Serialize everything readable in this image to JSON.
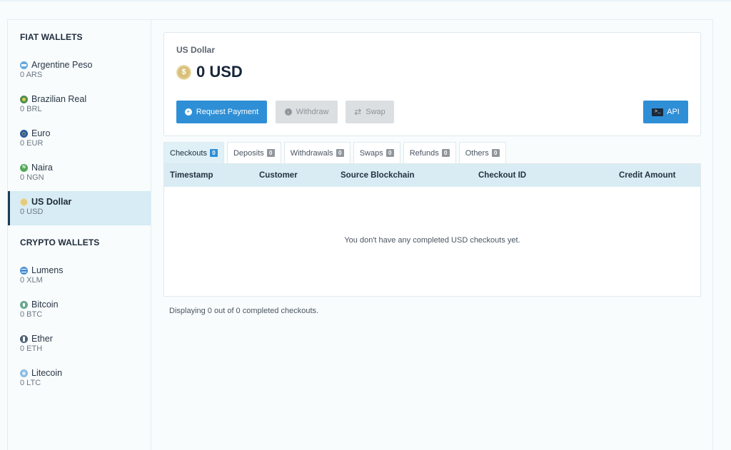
{
  "sidebar": {
    "fiat_title": "FIAT WALLETS",
    "crypto_title": "CRYPTO WALLETS",
    "fiat": [
      {
        "name": "Argentine Peso",
        "amount": "0 ARS",
        "icon": "ars-flag-icon",
        "color": "#6aa9e0",
        "glyph": ""
      },
      {
        "name": "Brazilian Real",
        "amount": "0 BRL",
        "icon": "brl-flag-icon",
        "color": "#4d8f4f",
        "glyph": ""
      },
      {
        "name": "Euro",
        "amount": "0 EUR",
        "icon": "eur-flag-icon",
        "color": "#2c5c9e",
        "glyph": ""
      },
      {
        "name": "Naira",
        "amount": "0 NGN",
        "icon": "ngn-flag-icon",
        "color": "#54a957",
        "glyph": "N"
      },
      {
        "name": "US Dollar",
        "amount": "0 USD",
        "icon": "usd-coin-icon",
        "color": "#e3cb7e",
        "glyph": ""
      }
    ],
    "crypto": [
      {
        "name": "Lumens",
        "amount": "0 XLM",
        "icon": "xlm-icon",
        "color": "#4a8fd0",
        "glyph": ""
      },
      {
        "name": "Bitcoin",
        "amount": "0 BTC",
        "icon": "btc-icon",
        "color": "#6aa88f",
        "glyph": ""
      },
      {
        "name": "Ether",
        "amount": "0 ETH",
        "icon": "eth-icon",
        "color": "#4d5f74",
        "glyph": ""
      },
      {
        "name": "Litecoin",
        "amount": "0 LTC",
        "icon": "ltc-icon",
        "color": "#8cbce0",
        "glyph": ""
      }
    ]
  },
  "card": {
    "currency_label": "US Dollar",
    "balance": "0 USD",
    "coin_glyph": "$",
    "buttons": {
      "request": "Request Payment",
      "withdraw": "Withdraw",
      "swap": "Swap",
      "api": "API"
    }
  },
  "tabs": [
    {
      "label": "Checkouts",
      "count": "0"
    },
    {
      "label": "Deposits",
      "count": "0"
    },
    {
      "label": "Withdrawals",
      "count": "0"
    },
    {
      "label": "Swaps",
      "count": "0"
    },
    {
      "label": "Refunds",
      "count": "0"
    },
    {
      "label": "Others",
      "count": "0"
    }
  ],
  "table": {
    "headers": [
      "Timestamp",
      "Customer",
      "Source Blockchain",
      "Checkout ID",
      "Credit Amount"
    ],
    "empty_message": "You don't have any completed USD checkouts yet."
  },
  "footer_note": "Displaying 0 out of 0 completed checkouts.",
  "colors": {
    "accent": "#2f8fd6",
    "active_bg": "#d7ecf4",
    "header_bg": "#d9ecf4"
  }
}
